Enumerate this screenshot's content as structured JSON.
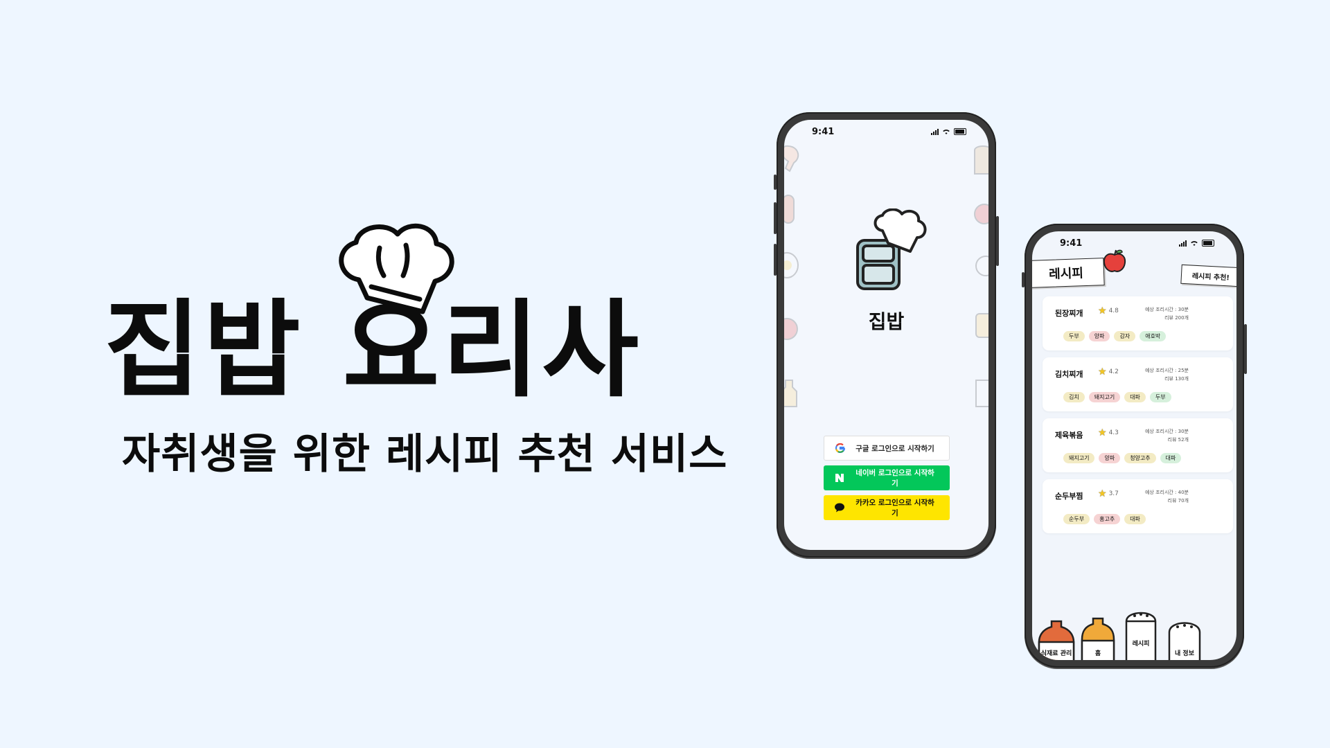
{
  "hero": {
    "title": "집밥 요리사",
    "subtitle": "자취생을 위한 레시피 추천 서비스"
  },
  "login_screen": {
    "status_time": "9:41",
    "app_name": "집밥",
    "buttons": {
      "google": "구글 로그인으로 시작하기",
      "naver": "네이버 로그인으로 시작하기",
      "kakao": "카카오 로그인으로 시작하기"
    },
    "colors": {
      "naver": "#03c75a",
      "kakao": "#fee500",
      "google": "#ffffff"
    }
  },
  "recipe_screen": {
    "status_time": "9:41",
    "header": "레시피",
    "recommend_button": "레시피 추천!",
    "cards": [
      {
        "name": "된장찌개",
        "rating": "4.8",
        "time": "예상 조리시간 : 30분",
        "reviews": "리뷰 200개",
        "tags": [
          "두부",
          "양파",
          "감자",
          "애호박"
        ]
      },
      {
        "name": "김치찌개",
        "rating": "4.2",
        "time": "예상 조리시간 : 25분",
        "reviews": "리뷰 130개",
        "tags": [
          "김치",
          "돼지고기",
          "대파",
          "두부"
        ]
      },
      {
        "name": "제육볶음",
        "rating": "4.3",
        "time": "예상 조리시간 : 30분",
        "reviews": "리뷰 52개",
        "tags": [
          "돼지고기",
          "양파",
          "청양고추",
          "대파"
        ]
      },
      {
        "name": "순두부찜",
        "rating": "3.7",
        "time": "예상 조리시간 : 40분",
        "reviews": "리뷰 70개",
        "tags": [
          "순두부",
          "홍고추",
          "대파"
        ]
      }
    ],
    "nav": {
      "ingredients": "식재료 관리",
      "home": "홈",
      "recipe": "레시피",
      "my_info": "내 정보"
    }
  }
}
